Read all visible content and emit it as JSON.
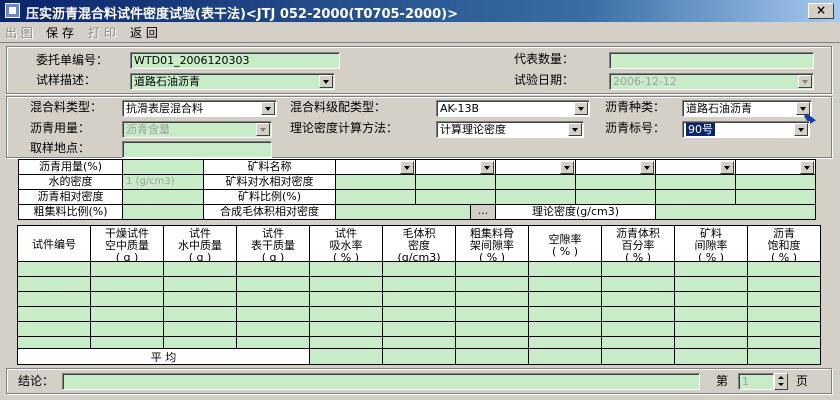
{
  "window": {
    "title": "压实沥青混合料试件密度试验(表干法)<JTJ 052-2000(T0705-2000)>",
    "close": "×",
    "icon": "app-icon"
  },
  "toolbar": {
    "preview": "出 图",
    "save": "保 存",
    "print": "打 印",
    "back": "返 回"
  },
  "form": {
    "entrust_no_label": "委托单编号：",
    "entrust_no": "WTD01_2006120303",
    "sample_desc_label": "试样描述：",
    "sample_desc": "道路石油沥青",
    "rep_qty_label": "代表数量：",
    "rep_qty": "",
    "test_date_label": "试验日期：",
    "test_date": "2006-12-12",
    "mix_type_label": "混合料类型：",
    "mix_type": "抗滑表层混合料",
    "grade_type_label": "混合料级配类型：",
    "grade_type": "AK-13B",
    "asphalt_kind_label": "沥青种类：",
    "asphalt_kind": "道路石油沥青",
    "asphalt_amount_label": "沥青用量：",
    "asphalt_amount": "沥青含量",
    "calc_method_label": "理论密度计算方法：",
    "calc_method": "计算理论密度",
    "asphalt_grade_label": "沥青标号：",
    "asphalt_grade": "90号",
    "sample_place_label": "取样地点：",
    "sample_place": ""
  },
  "upper_grid": {
    "asphalt_pct": "沥青用量(%)",
    "water_density": "水的密度",
    "water_density_value": "1 (g/cm3)",
    "asphalt_rel_density": "沥青相对密度",
    "coarse_ratio": "粗集料比例(%)",
    "mineral_name": "矿料名称",
    "mineral_rel_density": "矿料对水相对密度",
    "mineral_ratio": "矿料比例(%)",
    "synth_density": "合成毛体积相对密度",
    "ellipsis": "...",
    "theory_density": "理论密度(g/cm3)"
  },
  "table": {
    "headers": [
      {
        "l1": "试件编号",
        "l2": "",
        "l3": ""
      },
      {
        "l1": "干燥试件",
        "l2": "空中质量",
        "l3": "( g )"
      },
      {
        "l1": "试件",
        "l2": "水中质量",
        "l3": "( g )"
      },
      {
        "l1": "试件",
        "l2": "表干质量",
        "l3": "( g )"
      },
      {
        "l1": "试件",
        "l2": "吸水率",
        "l3": "( % )"
      },
      {
        "l1": "毛体积",
        "l2": "密度",
        "l3": "(g/cm3)"
      },
      {
        "l1": "粗集料骨",
        "l2": "架间隙率",
        "l3": "( % )"
      },
      {
        "l1": "空隙率",
        "l2": "( % )",
        "l3": ""
      },
      {
        "l1": "沥青体积",
        "l2": "百分率",
        "l3": "( % )"
      },
      {
        "l1": "矿料",
        "l2": "间隙率",
        "l3": "( % )"
      },
      {
        "l1": "沥青",
        "l2": "饱和度",
        "l3": "( % )"
      }
    ],
    "average_label": "平      均"
  },
  "footer": {
    "conclusion_label": "结论：",
    "conclusion": "",
    "page_label": "第",
    "page_value": "1",
    "page_suffix": "页"
  }
}
